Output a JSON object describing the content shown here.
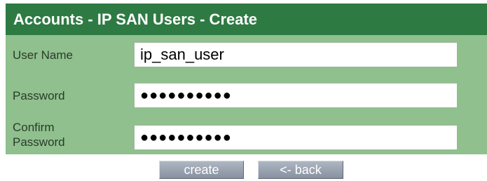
{
  "header": {
    "title": "Accounts - IP SAN Users - Create"
  },
  "form": {
    "user_name": {
      "label": "User Name",
      "value": "ip_san_user"
    },
    "password": {
      "label": "Password",
      "value": "●●●●●●●●●●"
    },
    "confirm_password": {
      "label_line1": "Confirm",
      "label_line2": "Password",
      "value": "●●●●●●●●●●"
    }
  },
  "actions": {
    "create_label": "create",
    "back_label": "<- back"
  },
  "colors": {
    "title_bar": "#2e7a43",
    "form_background": "#8fc08d",
    "button": "#99a2ae"
  }
}
